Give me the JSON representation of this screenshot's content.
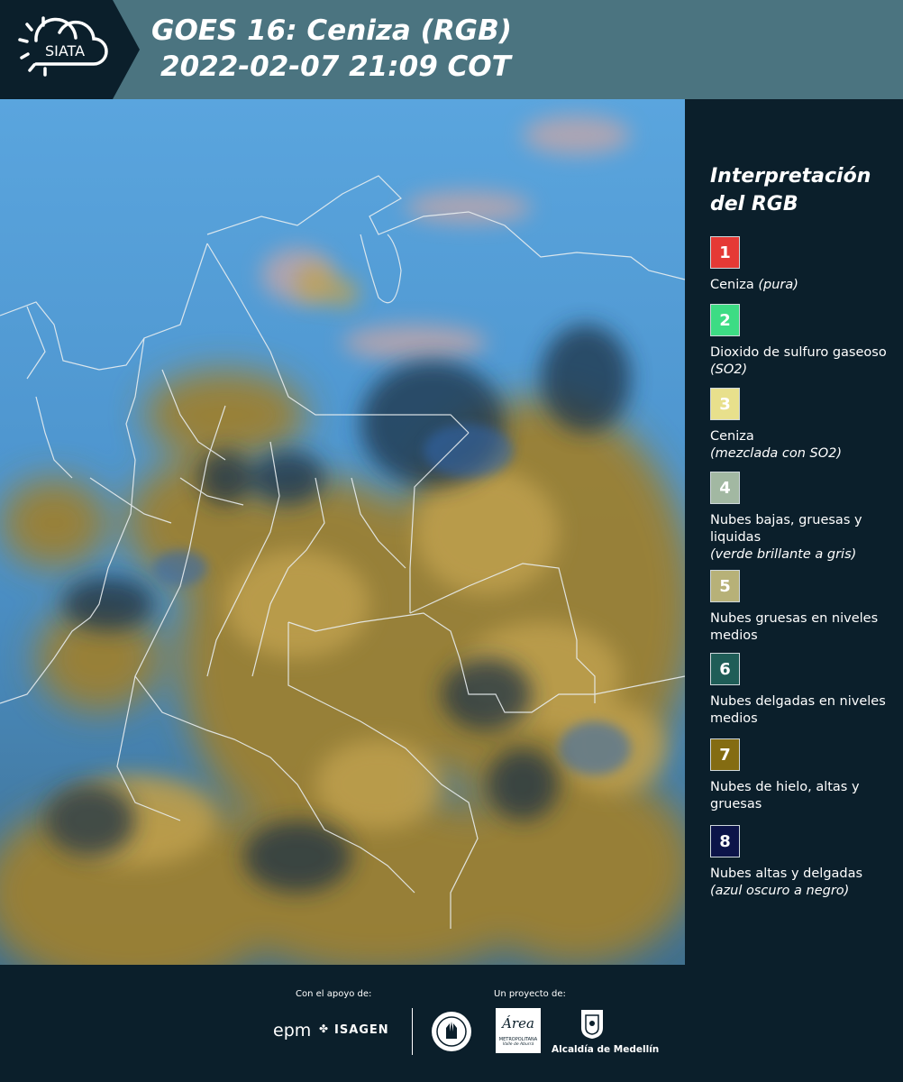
{
  "header": {
    "logo_text": "SIATA",
    "title_line1": "GOES 16: Ceniza (RGB)",
    "title_line2": "2022-02-07 21:09 COT"
  },
  "legend": {
    "title_line1": "Interpretación",
    "title_line2": "del RGB",
    "items": [
      {
        "number": "1",
        "color": "#e53935",
        "text": "Ceniza",
        "note": "(pura)"
      },
      {
        "number": "2",
        "color": "#3ddc84",
        "text": "Dioxido de sulfuro gaseoso",
        "note": "(SO2)"
      },
      {
        "number": "3",
        "color": "#e8e08c",
        "text": "Ceniza",
        "note": "(mezclada con SO2)"
      },
      {
        "number": "4",
        "color": "#a2b8a2",
        "text": "Nubes bajas, gruesas y liquidas",
        "note": "(verde brillante a gris)"
      },
      {
        "number": "5",
        "color": "#b7b178",
        "text": "Nubes gruesas en niveles medios",
        "note": ""
      },
      {
        "number": "6",
        "color": "#1f5d57",
        "text": "Nubes delgadas en niveles medios",
        "note": ""
      },
      {
        "number": "7",
        "color": "#846c12",
        "text": "Nubes de hielo, altas y gruesas",
        "note": ""
      },
      {
        "number": "8",
        "color": "#0c1449",
        "text": "Nubes altas y delgadas",
        "note": "(azul oscuro a negro)"
      }
    ]
  },
  "footer": {
    "support_label": "Con el apoyo de:",
    "project_label": "Un proyecto de:",
    "sponsor1": "epm",
    "sponsor2": "ISAGEN",
    "partner_area": "Área",
    "partner_area_sub": "METROPOLITANA",
    "partner_area_sub2": "Valle de Aburrá",
    "partner_medellin": "Alcaldía de Medellín"
  }
}
